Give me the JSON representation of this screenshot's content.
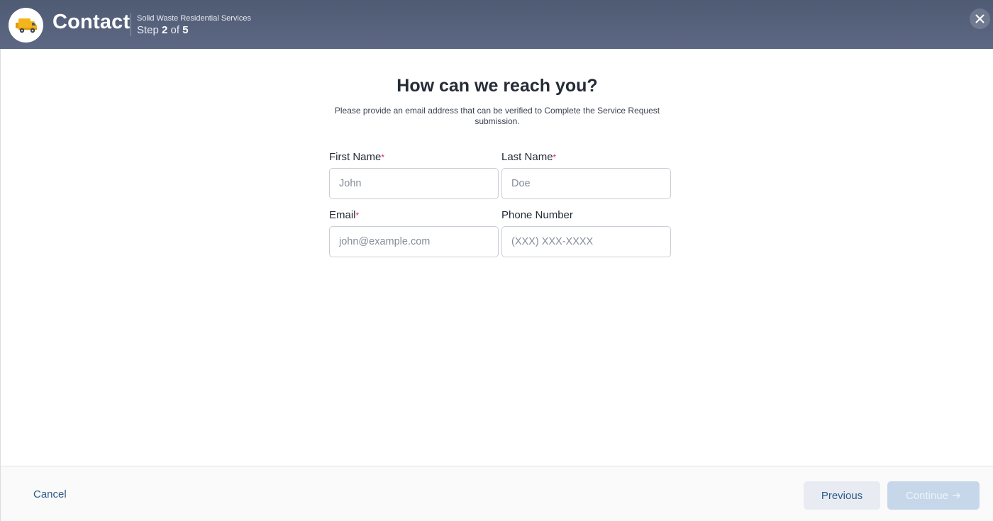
{
  "header": {
    "title": "Contact",
    "service": "Solid Waste Residential Services",
    "step_word": "Step",
    "step_current": "2",
    "step_of": "of",
    "step_total": "5",
    "logo_icon": "garbage-truck-icon",
    "close_icon": "close-icon"
  },
  "main": {
    "heading": "How can we reach you?",
    "subheading": "Please provide an email address that can be verified to Complete the Service Request submission.",
    "fields": [
      {
        "label": "First Name",
        "required_mark": "*",
        "value": "",
        "placeholder": "John"
      },
      {
        "label": "Last Name",
        "required_mark": "*",
        "value": "",
        "placeholder": "Doe"
      },
      {
        "label": "Email",
        "required_mark": "*",
        "value": "",
        "placeholder": "john@example.com"
      },
      {
        "label": "Phone Number",
        "required_mark": "",
        "value": "",
        "placeholder": "(XXX) XXX-XXXX"
      }
    ]
  },
  "footer": {
    "cancel_label": "Cancel",
    "previous_label": "Previous",
    "continue_label": "Continue",
    "continue_icon": "arrow-right-icon"
  },
  "colors": {
    "header_bg": "#56617b",
    "accent": "#2c5a8c",
    "required": "#e0245e",
    "truck": "#f2b51c"
  }
}
